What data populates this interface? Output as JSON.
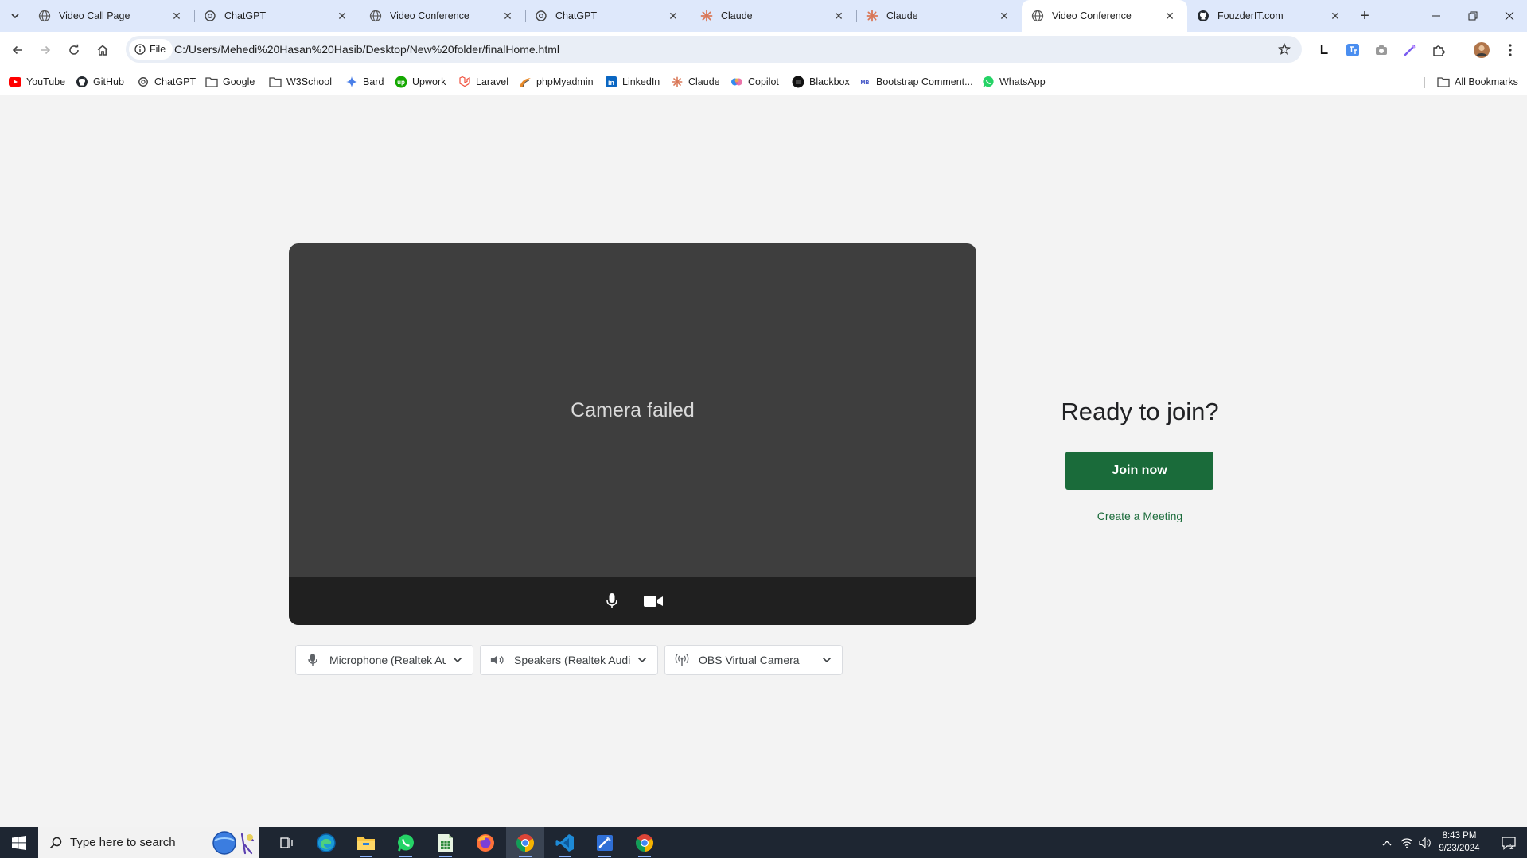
{
  "browser": {
    "tabs": [
      {
        "title": "Video Call Page",
        "icon": "globe-icon",
        "active": false
      },
      {
        "title": "ChatGPT",
        "icon": "chatgpt-icon",
        "active": false
      },
      {
        "title": "Video Conference",
        "icon": "globe-icon",
        "active": false
      },
      {
        "title": "ChatGPT",
        "icon": "chatgpt-icon",
        "active": false
      },
      {
        "title": "Claude",
        "icon": "claude-icon",
        "active": false
      },
      {
        "title": "Claude",
        "icon": "claude-icon",
        "active": false
      },
      {
        "title": "Video Conference",
        "icon": "globe-icon",
        "active": true
      },
      {
        "title": "FouzderIT.com",
        "icon": "github-icon",
        "active": false
      }
    ],
    "address": {
      "scheme_chip": "File",
      "url": "C:/Users/Mehedi%20Hasan%20Hasib/Desktop/New%20folder/finalHome.html"
    },
    "bookmarks": [
      {
        "label": "YouTube",
        "icon": "youtube-icon"
      },
      {
        "label": "GitHub",
        "icon": "github-icon"
      },
      {
        "label": "ChatGPT",
        "icon": "chatgpt-icon"
      },
      {
        "label": "Google",
        "icon": "folder-icon"
      },
      {
        "label": "W3School",
        "icon": "folder-icon"
      },
      {
        "label": "Bard",
        "icon": "bard-icon"
      },
      {
        "label": "Upwork",
        "icon": "upwork-icon"
      },
      {
        "label": "Laravel",
        "icon": "laravel-icon"
      },
      {
        "label": "phpMyadmin",
        "icon": "phpmyadmin-icon"
      },
      {
        "label": "LinkedIn",
        "icon": "linkedin-icon"
      },
      {
        "label": "Claude",
        "icon": "claude-icon"
      },
      {
        "label": "Copilot",
        "icon": "copilot-icon"
      },
      {
        "label": "Blackbox",
        "icon": "blackbox-icon"
      },
      {
        "label": "Bootstrap Comment...",
        "icon": "bootstrap-icon"
      },
      {
        "label": "WhatsApp",
        "icon": "whatsapp-icon"
      }
    ],
    "all_bookmarks_label": "All Bookmarks",
    "toolbar_extension_letter": "L"
  },
  "page": {
    "camera_message": "Camera failed",
    "devices": {
      "microphone": "Microphone (Realtek Audio)",
      "speakers": "Speakers (Realtek Audio)",
      "camera": "OBS Virtual Camera"
    },
    "join": {
      "heading": "Ready to join?",
      "join_button": "Join now",
      "create_link": "Create a Meeting"
    }
  },
  "taskbar": {
    "search_placeholder": "Type here to search",
    "time": "8:43 PM",
    "date": "9/23/2024",
    "notification_count": "2",
    "apps": [
      "task-view-icon",
      "edge-icon",
      "file-explorer-icon",
      "whatsapp-icon",
      "spreadsheet-icon",
      "firefox-icon",
      "chrome-icon",
      "vscode-icon",
      "paint-icon",
      "chrome-icon"
    ]
  },
  "colors": {
    "tab_strip": "#dee8fb",
    "page_background": "#f3f3f3",
    "video_background": "#3e3e3e",
    "video_controls": "#202020",
    "accent_green": "#1a6b3a",
    "taskbar": "#1e2632"
  }
}
